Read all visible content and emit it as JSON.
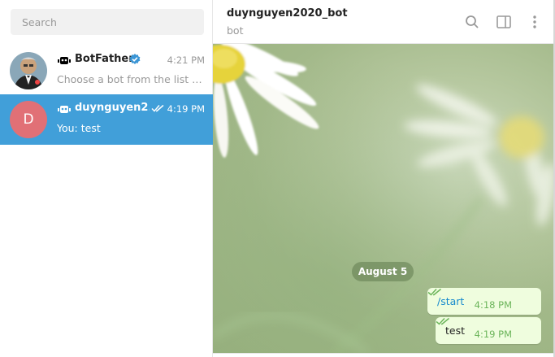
{
  "search": {
    "placeholder": "Search"
  },
  "chats": [
    {
      "name": "BotFather",
      "time": "4:21 PM",
      "preview": "Choose a bot from the list be...",
      "verified": true,
      "avatar_icon": "botfather-avatar"
    },
    {
      "name": "duynguyen2...",
      "time": "4:19 PM",
      "preview": "You: test",
      "avatar_letter": "D",
      "avatar_color": "#e17076",
      "active": true,
      "read_ticks": true
    }
  ],
  "header": {
    "title": "duynguyen2020_bot",
    "status": "bot",
    "icons": [
      "search-icon",
      "sidebar-toggle-icon",
      "more-vertical-icon"
    ]
  },
  "conversation": {
    "date_label": "August 5",
    "messages": [
      {
        "text": "/start",
        "time": "4:18 PM",
        "is_command": true,
        "read": true
      },
      {
        "text": "test",
        "time": "4:19 PM",
        "is_command": false,
        "read": true
      }
    ]
  },
  "colors": {
    "accent": "#419fd9",
    "command_link": "#168acd",
    "outgoing_bubble": "#effdde",
    "outgoing_meta": "#6cb55b",
    "verified": "#3a95d5"
  }
}
